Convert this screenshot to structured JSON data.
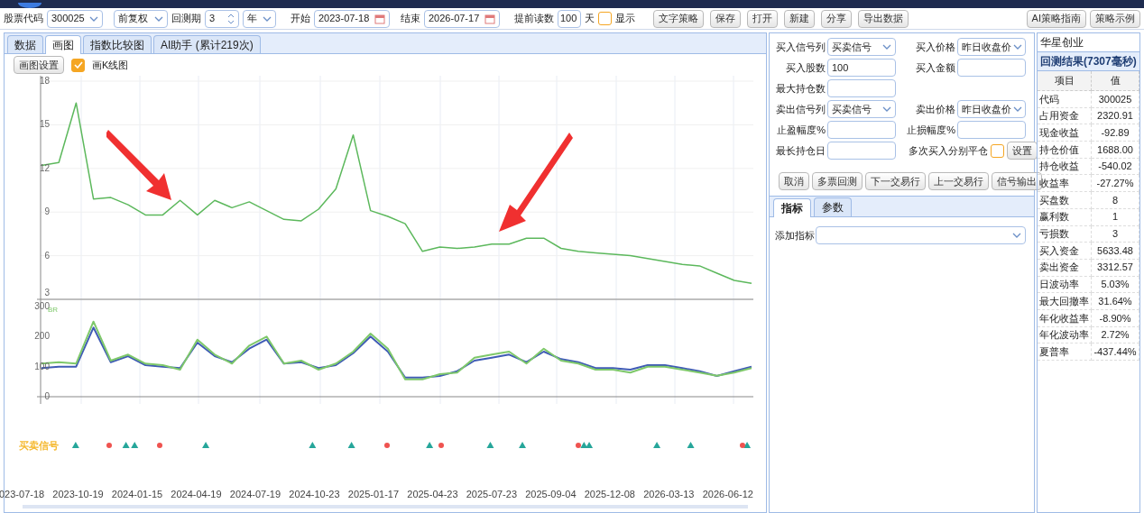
{
  "toolbar": {
    "stock_code_label": "股票代码",
    "stock_code": "300025",
    "adjust": "前复权",
    "period_label": "回测期",
    "period": "3",
    "period_unit": "年",
    "start_label": "开始",
    "start": "2023-07-18",
    "end_label": "结束",
    "end": "2026-07-17",
    "preload_label": "提前读数",
    "preload": "100",
    "preload_unit": "天",
    "show": {
      "label": "显示",
      "checked": false
    },
    "buttons": [
      "文字策略",
      "保存",
      "打开",
      "新建",
      "分享",
      "导出数据"
    ],
    "right_buttons": [
      "AI策略指南",
      "策略示例"
    ]
  },
  "tabs": [
    {
      "label": "数据",
      "selected": false
    },
    {
      "label": "画图",
      "selected": true
    },
    {
      "label": "指数比较图",
      "selected": false
    },
    {
      "label": "AI助手 (累计219次)",
      "selected": false
    }
  ],
  "chart_toolbar": {
    "settings_button": "画图设置",
    "kline": {
      "label": "画K线图",
      "checked": true
    }
  },
  "price_chart": {
    "chart_data": {
      "type": "line",
      "grid": true,
      "ylim": [
        3,
        18
      ],
      "yticks": [
        3,
        6,
        9,
        12,
        15,
        18
      ],
      "series": [
        {
          "color": "#5cb85c",
          "values": [
            12.2,
            12.4,
            16.5,
            9.9,
            10.0,
            9.5,
            8.8,
            8.8,
            9.8,
            8.8,
            9.8,
            9.3,
            9.7,
            9.1,
            8.5,
            8.4,
            9.2,
            10.6,
            14.3,
            9.1,
            8.7,
            8.2,
            6.3,
            6.6,
            6.5,
            6.6,
            6.8,
            6.8,
            7.2,
            7.2,
            6.5,
            6.3,
            6.2,
            6.1,
            6.0,
            5.8,
            5.6,
            5.4,
            5.3,
            4.8,
            4.3,
            4.1
          ]
        }
      ]
    }
  },
  "indicator_chart": {
    "legend": "BR",
    "chart_data": {
      "type": "line",
      "grid": true,
      "ylim": [
        0,
        300
      ],
      "yticks": [
        0,
        100,
        200,
        300
      ],
      "series": [
        {
          "color": "#3f5bb5",
          "values": [
            95,
            100,
            100,
            230,
            115,
            135,
            105,
            100,
            95,
            180,
            135,
            115,
            160,
            190,
            110,
            115,
            95,
            105,
            145,
            200,
            150,
            64,
            64,
            69,
            85,
            120,
            130,
            140,
            115,
            150,
            125,
            115,
            95,
            95,
            90,
            105,
            105,
            95,
            85,
            69,
            85,
            100
          ]
        },
        {
          "color": "#7ec86a",
          "values": [
            110,
            115,
            110,
            250,
            120,
            140,
            110,
            105,
            90,
            190,
            140,
            110,
            170,
            200,
            110,
            120,
            90,
            110,
            150,
            210,
            160,
            58,
            58,
            75,
            80,
            130,
            140,
            150,
            110,
            160,
            120,
            110,
            90,
            90,
            80,
            100,
            100,
            90,
            80,
            70,
            80,
            95
          ]
        }
      ]
    }
  },
  "signal_label": "买卖信号",
  "x_axis_labels": [
    "023-07-18",
    "2023-10-19",
    "2024-01-15",
    "2024-04-19",
    "2024-07-19",
    "2024-10-23",
    "2025-01-17",
    "2025-04-23",
    "2025-07-23",
    "2025-09-04",
    "2025-12-08",
    "2026-03-13",
    "2026-06-12"
  ],
  "form": {
    "rows": [
      [
        {
          "kind": "select",
          "label": "买入信号列",
          "value": "买卖信号"
        },
        {
          "kind": "select",
          "label": "买入价格",
          "value": "昨日收盘价"
        }
      ],
      [
        {
          "kind": "input",
          "label": "买入股数",
          "value": "100"
        },
        {
          "kind": "input",
          "label": "买入金额"
        }
      ],
      [
        {
          "kind": "input",
          "label": "最大持仓数"
        }
      ],
      [
        {
          "kind": "select",
          "label": "卖出信号列",
          "value": "买卖信号"
        },
        {
          "kind": "select",
          "label": "卖出价格",
          "value": "昨日收盘价"
        }
      ],
      [
        {
          "kind": "input",
          "label": "止盈幅度%"
        },
        {
          "kind": "input",
          "label": "止损幅度%"
        }
      ],
      [
        {
          "kind": "input",
          "label": "最长持仓日"
        },
        {
          "kind": "checkbox",
          "label": "多次买入分别平仓",
          "checked": false,
          "button": "设置"
        }
      ]
    ],
    "action_buttons": [
      "取消",
      "多票回测",
      "下一交易行",
      "上一交易行",
      "信号输出"
    ]
  },
  "panel_tabs": [
    {
      "label": "指标",
      "selected": true
    },
    {
      "label": "参数",
      "selected": false
    }
  ],
  "add_indicator": {
    "label": "添加指标"
  },
  "results": {
    "stock_name": "华星创业",
    "title": "回测结果(7307毫秒)",
    "columns": [
      "项目",
      "值"
    ],
    "rows": [
      [
        "代码",
        "300025"
      ],
      [
        "占用资金",
        "2320.91"
      ],
      [
        "现金收益",
        "-92.89"
      ],
      [
        "持仓价值",
        "1688.00"
      ],
      [
        "持仓收益",
        "-540.02"
      ],
      [
        "收益率",
        "-27.27%"
      ],
      [
        "买盘数",
        "8"
      ],
      [
        "赢利数",
        "1"
      ],
      [
        "亏损数",
        "3"
      ],
      [
        "买入资金",
        "5633.48"
      ],
      [
        "卖出资金",
        "3312.57"
      ],
      [
        "日波动率",
        "5.03%"
      ],
      [
        "最大回撤率",
        "31.64%"
      ],
      [
        "年化收益率",
        "-8.90%"
      ],
      [
        "年化波动率",
        "2.72%"
      ],
      [
        "夏普率",
        "-437.44%"
      ]
    ]
  }
}
